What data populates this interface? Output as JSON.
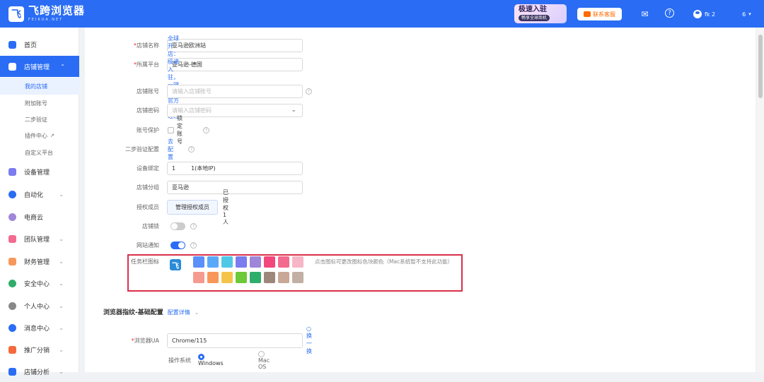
{
  "header": {
    "logo_mark": "飞",
    "logo_title": "飞跨浏览器",
    "logo_sub": "FEIKUA.NET",
    "promo_title": "极速入驻",
    "promo_sub": "畅享全球商机",
    "contact": "联系客服",
    "user_name": "fk 2",
    "user_suffix": "6"
  },
  "sidebar": {
    "items": [
      {
        "label": "首页"
      },
      {
        "label": "店铺管理"
      },
      {
        "label": "设备管理"
      },
      {
        "label": "自动化"
      },
      {
        "label": "电商云"
      },
      {
        "label": "团队管理"
      },
      {
        "label": "财务管理"
      },
      {
        "label": "安全中心"
      },
      {
        "label": "个人中心"
      },
      {
        "label": "消息中心"
      },
      {
        "label": "推广分销"
      },
      {
        "label": "店铺分析"
      }
    ],
    "sub_items": [
      {
        "label": "我的店铺"
      },
      {
        "label": "附加账号"
      },
      {
        "label": "二步验证"
      },
      {
        "label": "插件中心"
      },
      {
        "label": "自定义平台"
      }
    ]
  },
  "form": {
    "store_name_label": "店铺名称",
    "store_name": "亚马逊欧洲站",
    "platform_label": "所属平台",
    "platform": "亚马逊-德国",
    "platform_hint": "全球开店：极速入驻，一键对接官方招商经理",
    "account_label": "店铺账号",
    "account_ph": "请输入店铺账号",
    "password_label": "店铺密码",
    "password_ph": "请输入店铺密码",
    "protect_label": "账号保护",
    "protect_check": "锁定账号",
    "twostep_label": "二步验证配置",
    "twostep_link": "去配置",
    "device_label": "设备绑定",
    "device_value": "1",
    "device_suffix": "1(本地IP)",
    "group_label": "店铺分组",
    "group_value": "亚马逊",
    "members_label": "授权成员",
    "members_btn": "管理授权成员",
    "members_count": "已授权1人",
    "lock_label": "店铺锁",
    "notify_label": "网站通知",
    "taskbar_label": "任务栏图标",
    "taskbar_hint": "点击图标可更改图标色块颜色（Mac系统暂不支持此功能）"
  },
  "swatches_row1": [
    "#5b8ff9",
    "#5aa9f8",
    "#4fc8e6",
    "#7b7cf0",
    "#9f86d8",
    "#f2467d",
    "#f36a8e",
    "#f7b6c6"
  ],
  "swatches_row2": [
    "#f59a8f",
    "#f8975a",
    "#f6c34a",
    "#6cc937",
    "#2fad6a",
    "#9c877a",
    "#c9a898",
    "#c2b0a4"
  ],
  "fingerprint": {
    "title": "浏览器指纹-基础配置",
    "detail_link": "配置详情",
    "ua_label": "浏览器UA",
    "ua_value": "Chrome/115",
    "ua_refresh": "换一换",
    "os_label": "操作系统",
    "os_windows": "Windows",
    "os_mac": "Mac OS"
  }
}
